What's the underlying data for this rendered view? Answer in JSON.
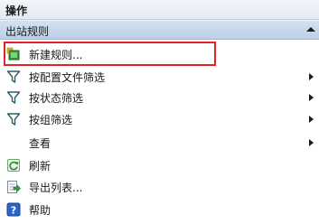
{
  "panel": {
    "title": "操作",
    "section": "出站规则",
    "items": [
      {
        "label": "新建规则...",
        "icon": "new-rule-icon"
      },
      {
        "label": "按配置文件筛选",
        "icon": "filter-icon"
      },
      {
        "label": "按状态筛选",
        "icon": "filter-icon"
      },
      {
        "label": "按组筛选",
        "icon": "filter-icon"
      },
      {
        "label": "查看",
        "icon": ""
      },
      {
        "label": "刷新",
        "icon": "refresh-icon"
      },
      {
        "label": "导出列表...",
        "icon": "export-list-icon"
      },
      {
        "label": "帮助",
        "icon": "help-icon"
      }
    ]
  },
  "colors": {
    "highlight_border": "#e0262b",
    "section_header": "#c6d7ed",
    "help_icon": "#2c63c7"
  }
}
